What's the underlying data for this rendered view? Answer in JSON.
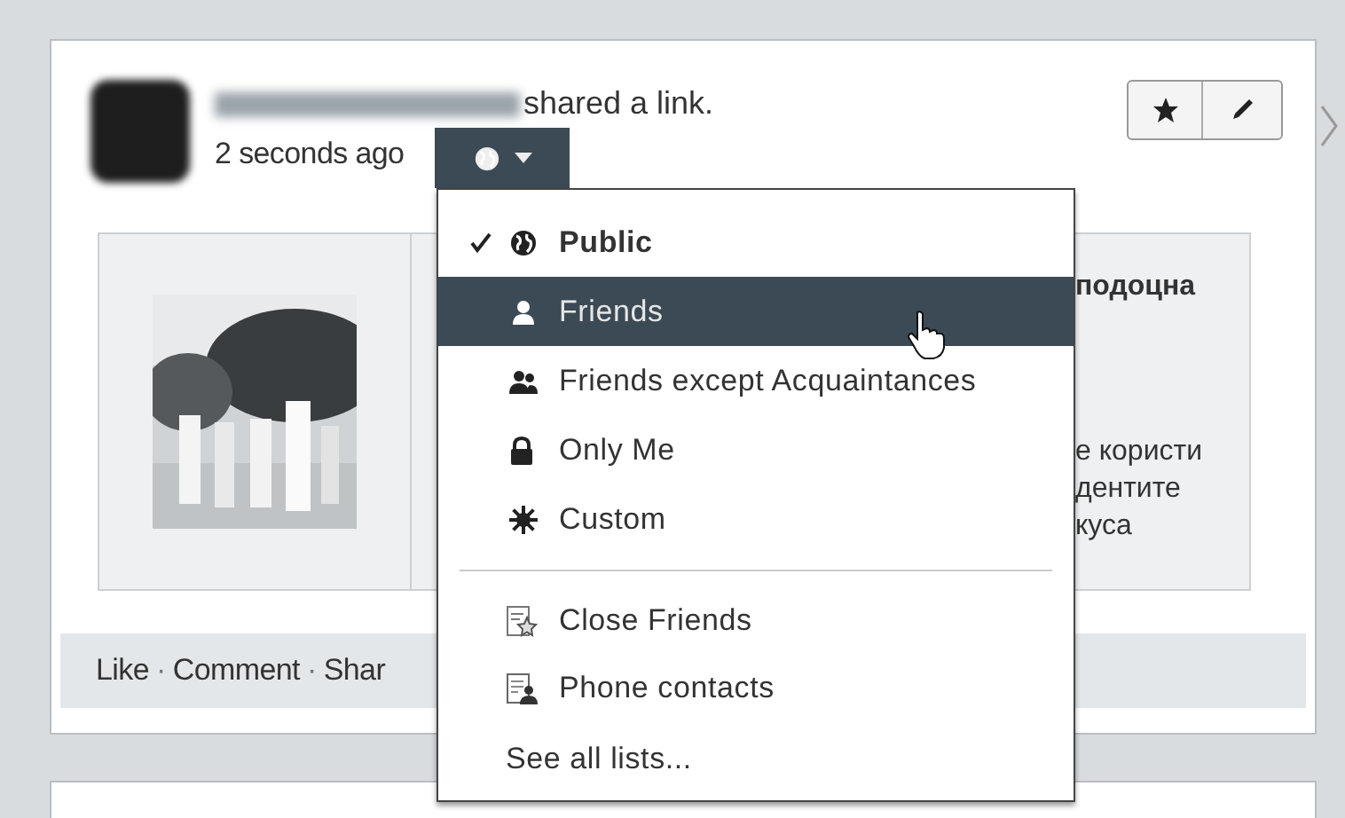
{
  "post": {
    "action": "shared a link.",
    "timestamp": "2 seconds ago"
  },
  "link_preview": {
    "title": "подоцна",
    "lines": [
      "е користи",
      "дентите",
      "куса"
    ]
  },
  "footer": {
    "links": [
      "Like",
      "Comment",
      "Shar"
    ],
    "separator": "·"
  },
  "privacy_menu": {
    "items": [
      {
        "label": "Public",
        "checked": true,
        "selected": false
      },
      {
        "label": "Friends",
        "checked": false,
        "selected": true
      },
      {
        "label": "Friends except Acquaintances",
        "checked": false,
        "selected": false
      },
      {
        "label": "Only Me",
        "checked": false,
        "selected": false
      },
      {
        "label": "Custom",
        "checked": false,
        "selected": false
      }
    ],
    "lists": [
      {
        "label": "Close Friends"
      },
      {
        "label": "Phone contacts"
      }
    ],
    "more": "See all lists..."
  }
}
